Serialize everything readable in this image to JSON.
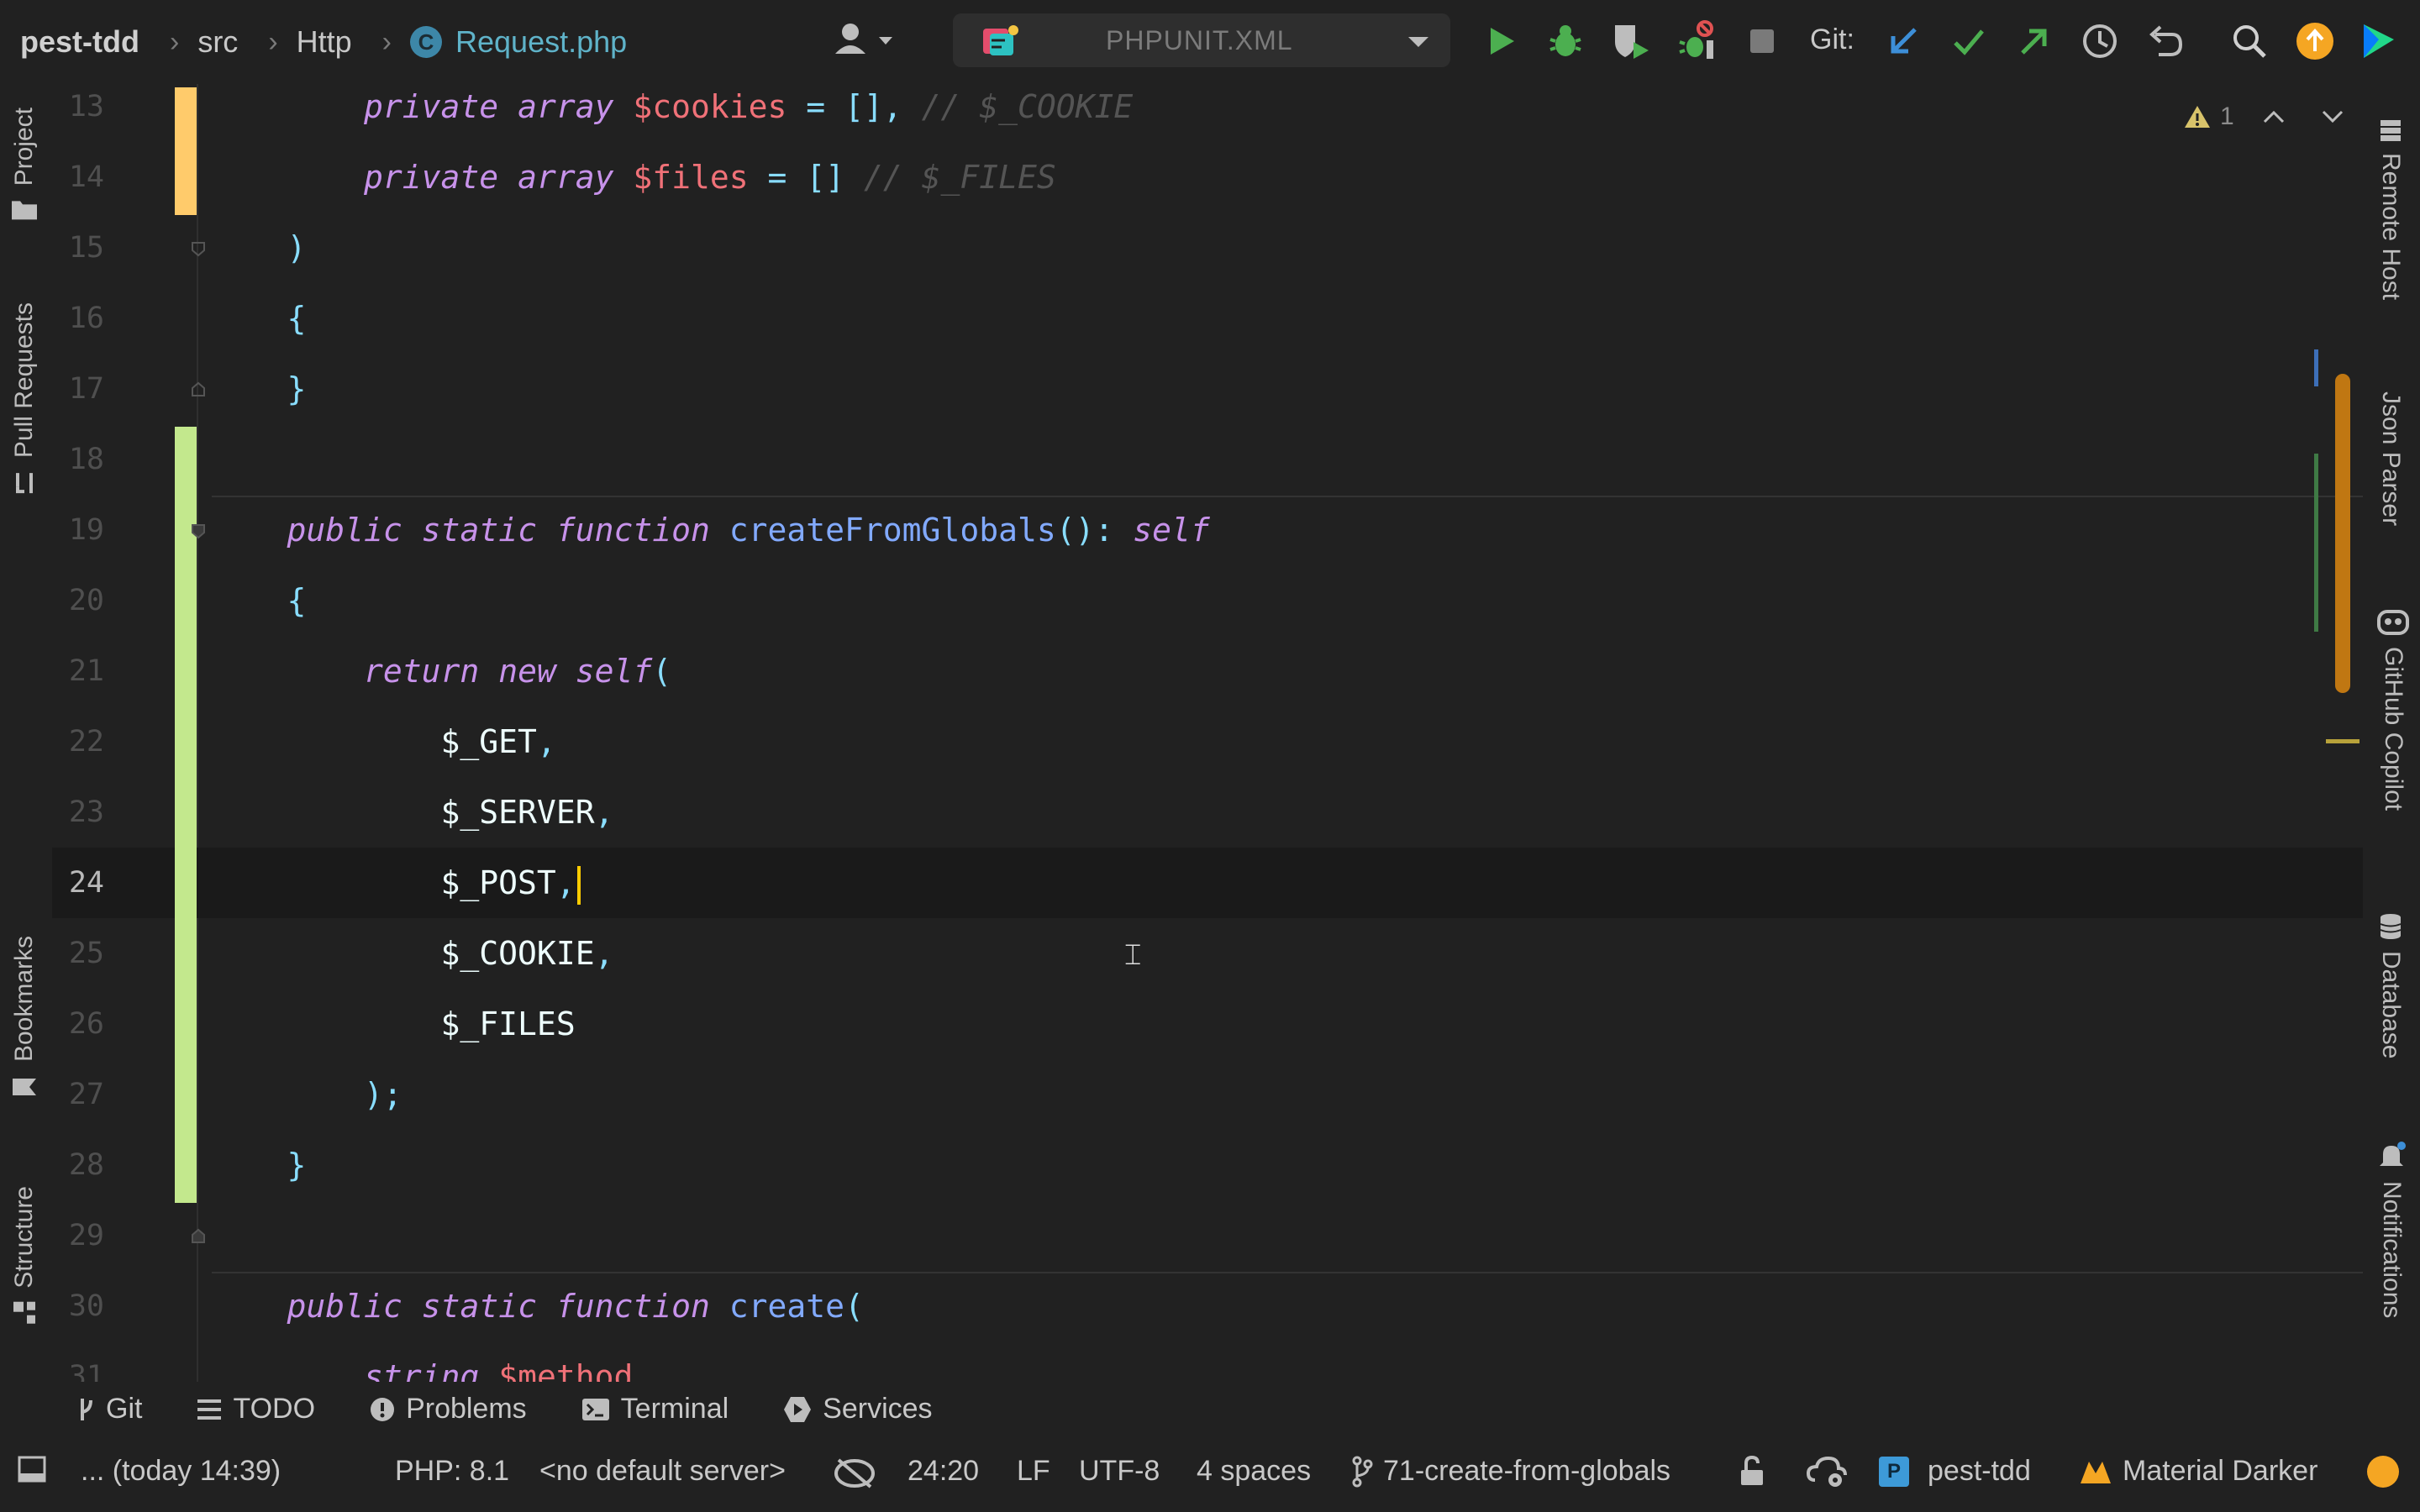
{
  "breadcrumb": {
    "project": "pest-tdd",
    "items": [
      "src",
      "Http"
    ],
    "file": "Request.php",
    "file_badge": "C"
  },
  "toolbar": {
    "run_config": "PHPUNIT.XML",
    "git_label": "Git:",
    "icons": [
      "user-menu-icon",
      "run-icon",
      "debug-icon",
      "coverage-icon",
      "profile-icon",
      "stop-icon",
      "git-update-icon",
      "git-commit-icon",
      "git-push-icon",
      "history-icon",
      "rollback-icon",
      "search-icon",
      "update-available-icon",
      "jetbrains-icon"
    ]
  },
  "left_tools": [
    "Project",
    "Pull Requests",
    "Bookmarks",
    "Structure"
  ],
  "right_tools": [
    "Remote Host",
    "Json Parser",
    "GitHub Copilot",
    "Database",
    "Notifications"
  ],
  "inspections": {
    "warnings": "1"
  },
  "editor": {
    "current_line": 24,
    "lines": [
      {
        "n": "13",
        "tokens": [
          [
            "",
            "        "
          ],
          [
            "kw",
            "private"
          ],
          [
            "plain",
            " "
          ],
          [
            "kw",
            "array"
          ],
          [
            "plain",
            " "
          ],
          [
            "var",
            "$cookies"
          ],
          [
            "plain",
            " "
          ],
          [
            "pn",
            "="
          ],
          [
            "plain",
            " "
          ],
          [
            "pn",
            "[],"
          ],
          [
            "plain",
            " "
          ],
          [
            "cm",
            "// $_COOKIE"
          ]
        ]
      },
      {
        "n": "14",
        "tokens": [
          [
            "",
            "        "
          ],
          [
            "kw",
            "private"
          ],
          [
            "plain",
            " "
          ],
          [
            "kw",
            "array"
          ],
          [
            "plain",
            " "
          ],
          [
            "var",
            "$files"
          ],
          [
            "plain",
            " "
          ],
          [
            "pn",
            "="
          ],
          [
            "plain",
            " "
          ],
          [
            "pn",
            "[]"
          ],
          [
            "plain",
            " "
          ],
          [
            "cm",
            "// $_FILES"
          ]
        ]
      },
      {
        "n": "15",
        "tokens": [
          [
            "",
            "    "
          ],
          [
            "pn",
            ")"
          ]
        ]
      },
      {
        "n": "16",
        "tokens": [
          [
            "",
            "    "
          ],
          [
            "pn",
            "{"
          ]
        ]
      },
      {
        "n": "17",
        "tokens": [
          [
            "",
            "    "
          ],
          [
            "pn",
            "}"
          ]
        ]
      },
      {
        "n": "18",
        "tokens": []
      },
      {
        "n": "19",
        "tokens": [
          [
            "",
            "    "
          ],
          [
            "kw",
            "public"
          ],
          [
            "plain",
            " "
          ],
          [
            "kw",
            "static"
          ],
          [
            "plain",
            " "
          ],
          [
            "kw",
            "function"
          ],
          [
            "plain",
            " "
          ],
          [
            "fn",
            "createFromGlobals"
          ],
          [
            "pn",
            "():"
          ],
          [
            "plain",
            " "
          ],
          [
            "kw",
            "self"
          ]
        ]
      },
      {
        "n": "20",
        "tokens": [
          [
            "",
            "    "
          ],
          [
            "pn",
            "{"
          ]
        ]
      },
      {
        "n": "21",
        "tokens": [
          [
            "",
            "        "
          ],
          [
            "kw",
            "return"
          ],
          [
            "plain",
            " "
          ],
          [
            "kw",
            "new"
          ],
          [
            "plain",
            " "
          ],
          [
            "kw",
            "self"
          ],
          [
            "pn",
            "("
          ]
        ]
      },
      {
        "n": "22",
        "tokens": [
          [
            "",
            "            "
          ],
          [
            "plain",
            "$_GET"
          ],
          [
            "pn",
            ","
          ]
        ]
      },
      {
        "n": "23",
        "tokens": [
          [
            "",
            "            "
          ],
          [
            "plain",
            "$_SERVER"
          ],
          [
            "pn",
            ","
          ]
        ]
      },
      {
        "n": "24",
        "tokens": [
          [
            "",
            "            "
          ],
          [
            "plain",
            "$_POST"
          ],
          [
            "pn",
            ","
          ]
        ]
      },
      {
        "n": "25",
        "tokens": [
          [
            "",
            "            "
          ],
          [
            "plain",
            "$_COOKIE"
          ],
          [
            "pn",
            ","
          ]
        ]
      },
      {
        "n": "26",
        "tokens": [
          [
            "",
            "            "
          ],
          [
            "plain",
            "$_FILES"
          ]
        ]
      },
      {
        "n": "27",
        "tokens": [
          [
            "",
            "        "
          ],
          [
            "pn",
            ");"
          ]
        ]
      },
      {
        "n": "28",
        "tokens": [
          [
            "",
            "    "
          ],
          [
            "pn",
            "}"
          ]
        ]
      },
      {
        "n": "29",
        "tokens": []
      },
      {
        "n": "30",
        "tokens": [
          [
            "",
            "    "
          ],
          [
            "kw",
            "public"
          ],
          [
            "plain",
            " "
          ],
          [
            "kw",
            "static"
          ],
          [
            "plain",
            " "
          ],
          [
            "kw",
            "function"
          ],
          [
            "plain",
            " "
          ],
          [
            "fn",
            "create"
          ],
          [
            "pn",
            "("
          ]
        ]
      },
      {
        "n": "31",
        "tokens": [
          [
            "",
            "        "
          ],
          [
            "kw",
            "string"
          ],
          [
            "plain",
            " "
          ],
          [
            "var",
            "$method"
          ]
        ]
      }
    ]
  },
  "bottom_tabs": [
    "Git",
    "TODO",
    "Problems",
    "Terminal",
    "Services"
  ],
  "status": {
    "last_change": "... (today 14:39)",
    "php": "PHP: 8.1",
    "server": "<no default server>",
    "position": "24:20",
    "line_sep": "LF",
    "encoding": "UTF-8",
    "indent": "4 spaces",
    "branch": "71-create-from-globals",
    "project": "pest-tdd",
    "project_badge": "P",
    "theme": "Material Darker"
  },
  "colors": {
    "background": "#212121",
    "keyword": "#c792ea",
    "variable": "#f07178",
    "function": "#82aaff",
    "punctuation": "#89ddff",
    "comment": "#545454",
    "added_bar": "#c3e88d",
    "modified_bar": "#ffcb6b",
    "scroll_thumb": "#c07712"
  }
}
